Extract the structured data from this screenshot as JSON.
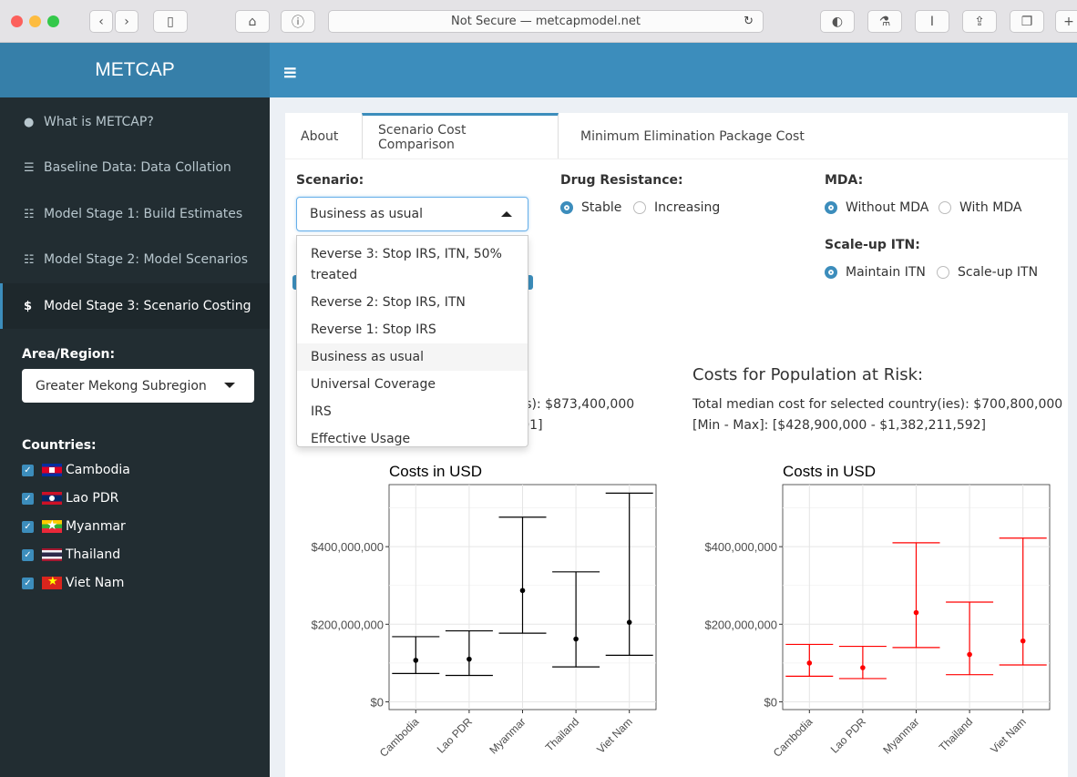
{
  "browser": {
    "url": "Not Secure — metcapmodel.net"
  },
  "app": {
    "title": "METCAP",
    "menu_icon": "hamburger-icon"
  },
  "sidebar": {
    "items": [
      {
        "label": "What is METCAP?",
        "icon": "info-icon"
      },
      {
        "label": "Baseline Data: Data Collation",
        "icon": "database-icon"
      },
      {
        "label": "Model Stage 1: Build Estimates",
        "icon": "sliders-icon"
      },
      {
        "label": "Model Stage 2: Model Scenarios",
        "icon": "sliders-icon"
      },
      {
        "label": "Model Stage 3: Scenario Costing",
        "icon": "dollar-icon"
      }
    ],
    "area_label": "Area/Region:",
    "area_value": "Greater Mekong Subregion",
    "countries_label": "Countries:",
    "countries": [
      "Cambodia",
      "Lao PDR",
      "Myanmar",
      "Thailand",
      "Viet Nam"
    ]
  },
  "tabs": [
    "About",
    "Scenario Cost Comparison",
    "Minimum Elimination Package Cost"
  ],
  "controls": {
    "scenario_label": "Scenario:",
    "scenario_value": "Business as usual",
    "scenario_options": [
      "Reverse 3: Stop IRS, ITN, 50%",
      "treated",
      "Reverse 2: Stop IRS, ITN",
      "Reverse 1: Stop IRS",
      "Business as usual",
      "Universal Coverage",
      "IRS",
      "Effective Usage"
    ],
    "drug_label": "Drug Resistance:",
    "drug_options": [
      "Stable",
      "Increasing"
    ],
    "mda_label": "MDA:",
    "mda_options": [
      "Without MDA",
      "With MDA"
    ],
    "itn_label": "Scale-up ITN:",
    "itn_options": [
      "Maintain ITN",
      "Scale-up ITN"
    ]
  },
  "summary": {
    "left_partial_1": "y(ies): $873,400,000",
    "left_partial_2": "3,101]",
    "right_title": "Costs for Population at Risk:",
    "right_line1": "Total median cost for selected country(ies): $700,800,000",
    "right_line2": "[Min - Max]: [$428,900,000 - $1,382,211,592]"
  },
  "chart_data": [
    {
      "type": "scatter",
      "title": "Costs in USD",
      "categories": [
        "Cambodia",
        "Lao PDR",
        "Myanmar",
        "Thailand",
        "Viet Nam"
      ],
      "median": [
        107000000,
        110000000,
        287000000,
        162000000,
        205000000
      ],
      "min": [
        73000000,
        68000000,
        177000000,
        90000000,
        120000000
      ],
      "max": [
        168000000,
        183000000,
        476000000,
        335000000,
        538000000
      ],
      "ylim": [
        -20000000,
        560000000
      ],
      "yticks": [
        "$0",
        "$200,000,000",
        "$400,000,000"
      ],
      "color": "#000000"
    },
    {
      "type": "scatter",
      "title": "Costs in USD",
      "categories": [
        "Cambodia",
        "Lao PDR",
        "Myanmar",
        "Thailand",
        "Viet Nam"
      ],
      "median": [
        100000000,
        88000000,
        230000000,
        122000000,
        157000000
      ],
      "min": [
        66000000,
        60000000,
        140000000,
        70000000,
        95000000
      ],
      "max": [
        148000000,
        143000000,
        410000000,
        257000000,
        422000000
      ],
      "ylim": [
        -20000000,
        560000000
      ],
      "yticks": [
        "$0",
        "$200,000,000",
        "$400,000,000"
      ],
      "color": "#ff0000"
    }
  ]
}
